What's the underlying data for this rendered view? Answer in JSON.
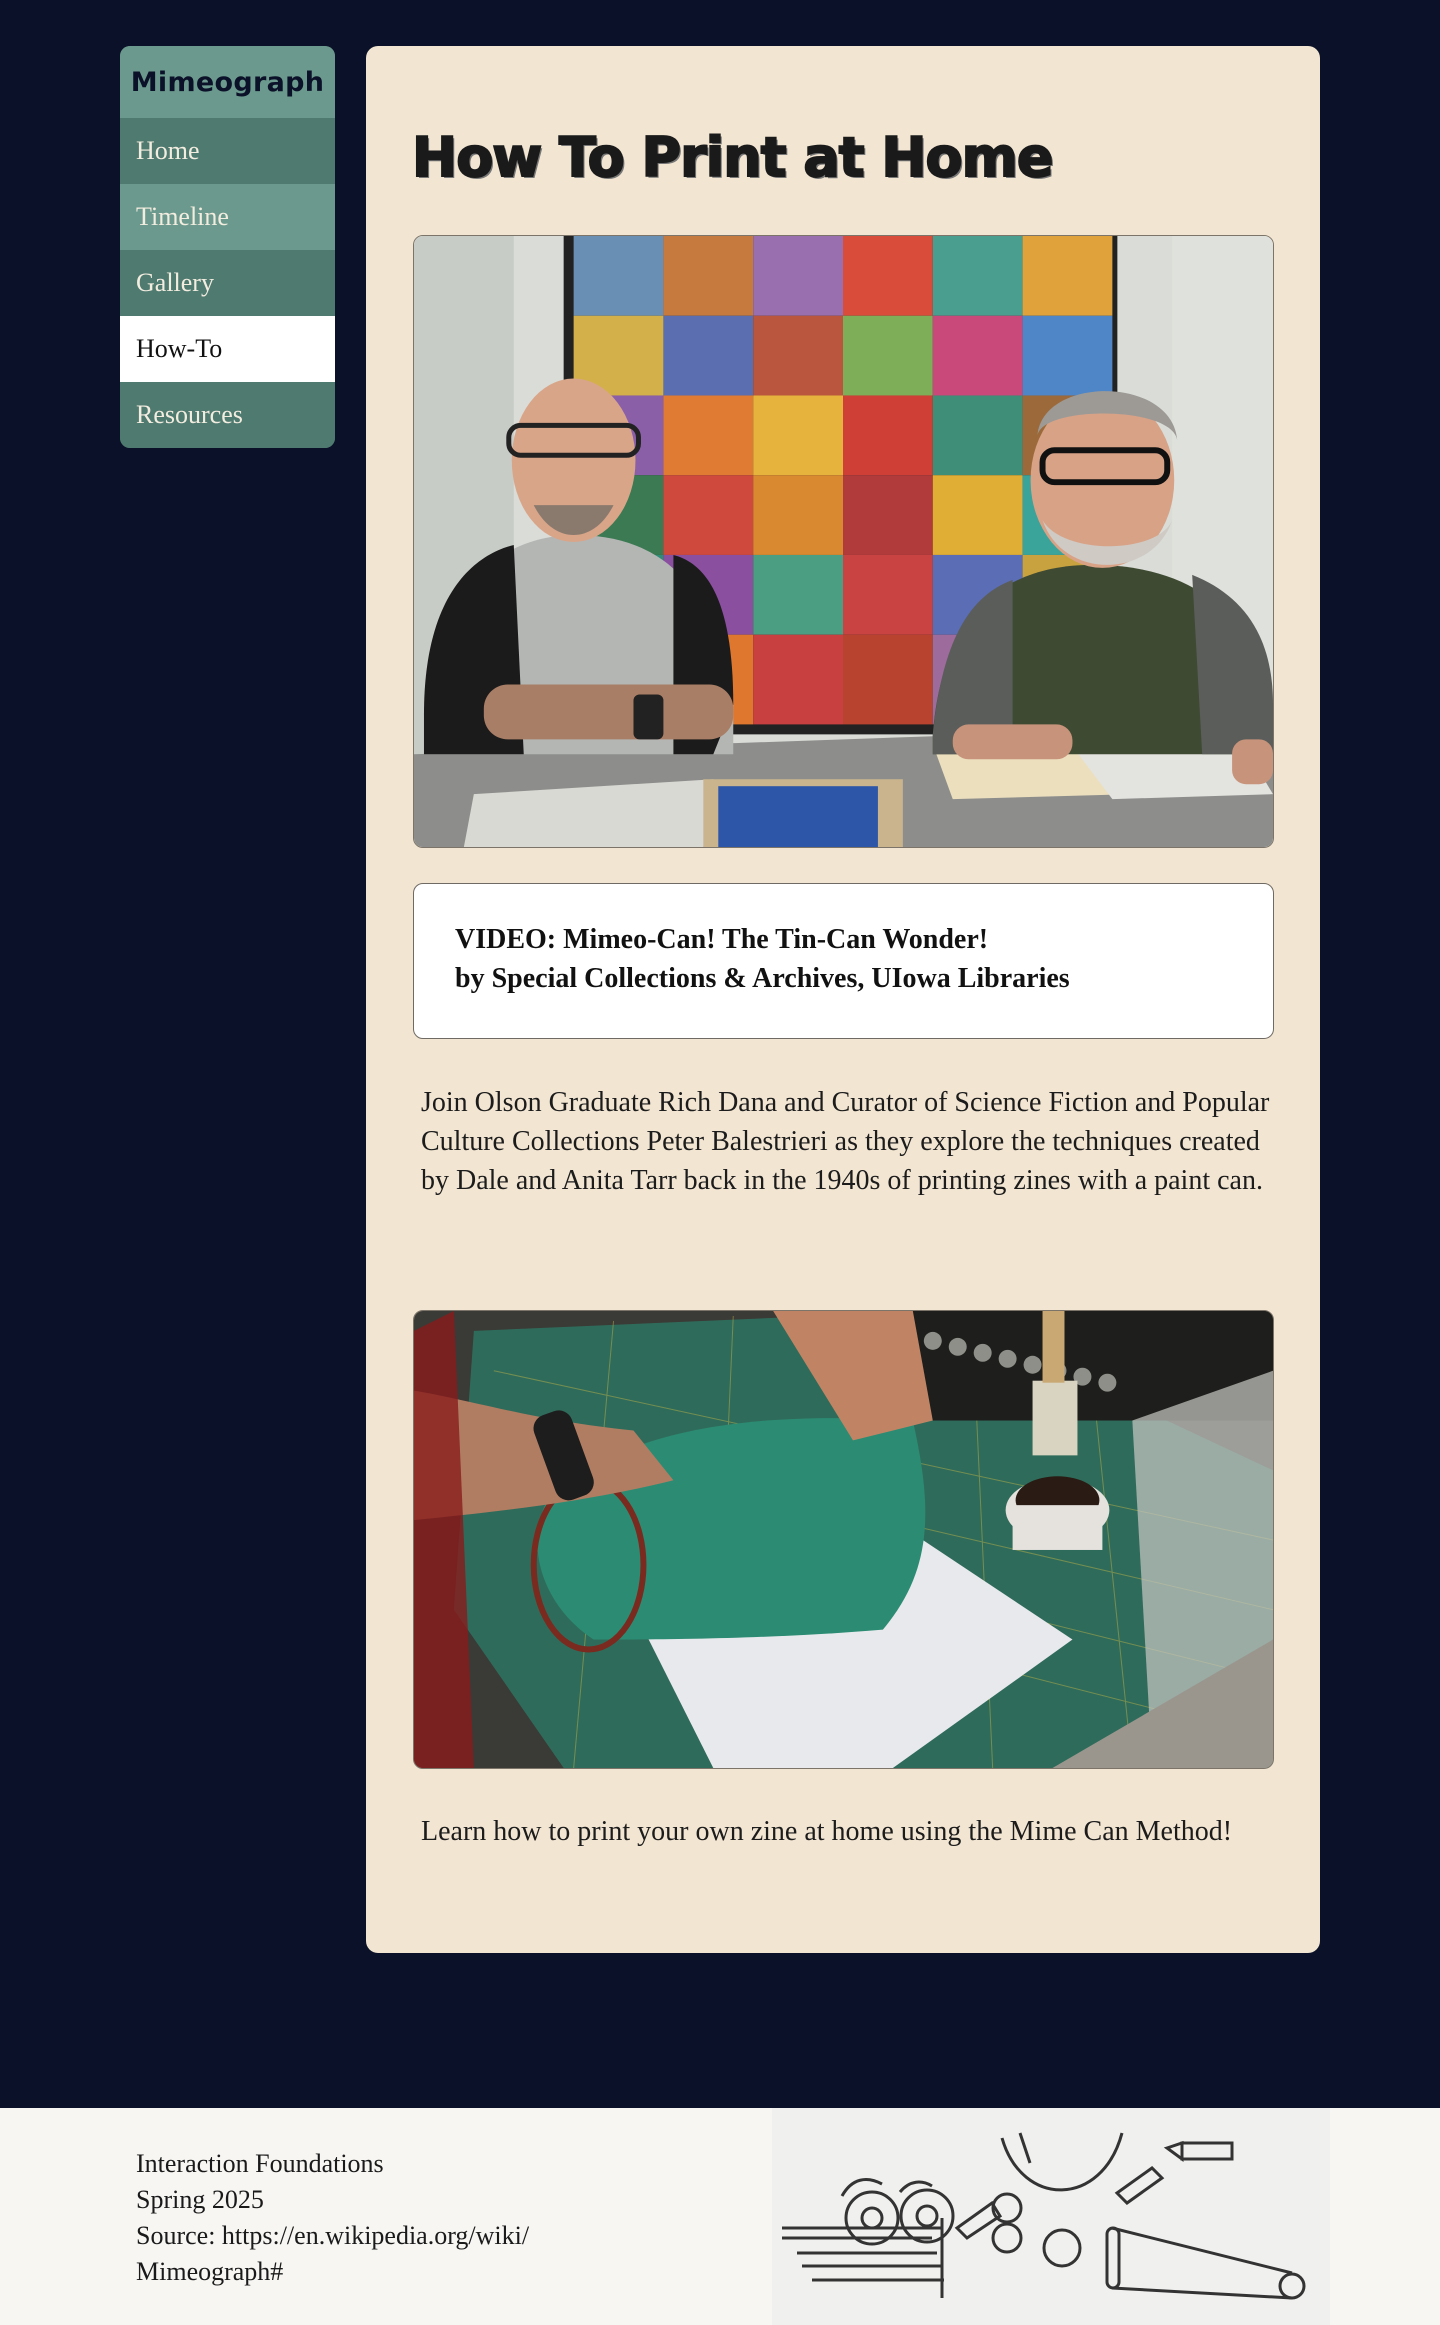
{
  "sidebar": {
    "brand": "Mimeograph",
    "items": [
      {
        "label": "Home"
      },
      {
        "label": "Timeline"
      },
      {
        "label": "Gallery"
      },
      {
        "label": "How-To"
      },
      {
        "label": "Resources"
      }
    ],
    "active": "How-To"
  },
  "main": {
    "title": "How To Print at Home",
    "video_caption_line1": "VIDEO: Mimeo-Can! The Tin-Can Wonder!",
    "video_caption_line2": "by Special Collections & Archives, UIowa Libraries",
    "paragraph1": "Join Olson Graduate Rich Dana and Curator of Science Fiction and Popular Culture Collections Peter Balestrieri as they explore the techniques created by Dale and Anita Tarr back in the 1940s of printing zines with a paint can.",
    "paragraph2": "Learn how to print your own zine at home using the Mime Can Method!"
  },
  "footer": {
    "line1": "Interaction Foundations",
    "line2": "Spring 2025",
    "line3": "Source: https://en.wikipedia.org/wiki/",
    "line4": "Mimeograph#"
  },
  "colors": {
    "background": "#0b1128",
    "card": "#f2e5d2",
    "sidebar_dark": "#4f7a70",
    "sidebar_light": "#6b998d",
    "active": "#ffffff"
  }
}
